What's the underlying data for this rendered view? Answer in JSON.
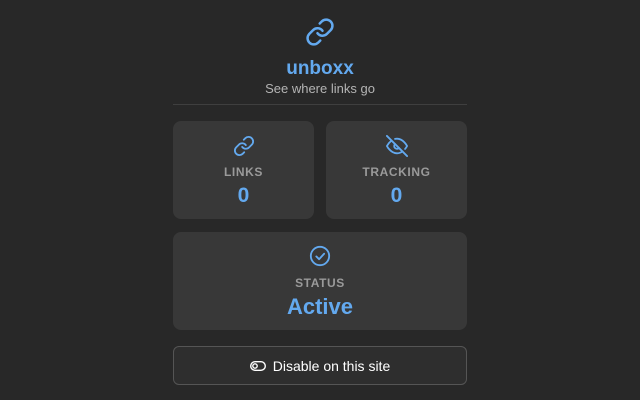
{
  "app": {
    "title": "unboxx",
    "subtitle": "See where links go",
    "logo_icon": "link-icon"
  },
  "colors": {
    "accent": "#63a9ef",
    "background": "#282828",
    "card": "#383838",
    "label": "#9a9a9a"
  },
  "stats": {
    "links": {
      "icon": "link-icon",
      "label": "LINKS",
      "value": "0"
    },
    "tracking": {
      "icon": "eye-off-icon",
      "label": "TRACKING",
      "value": "0"
    }
  },
  "status": {
    "icon": "check-circle-icon",
    "label": "STATUS",
    "value": "Active"
  },
  "toggle": {
    "icon": "toggle-off-icon",
    "label": "Disable on this site"
  }
}
